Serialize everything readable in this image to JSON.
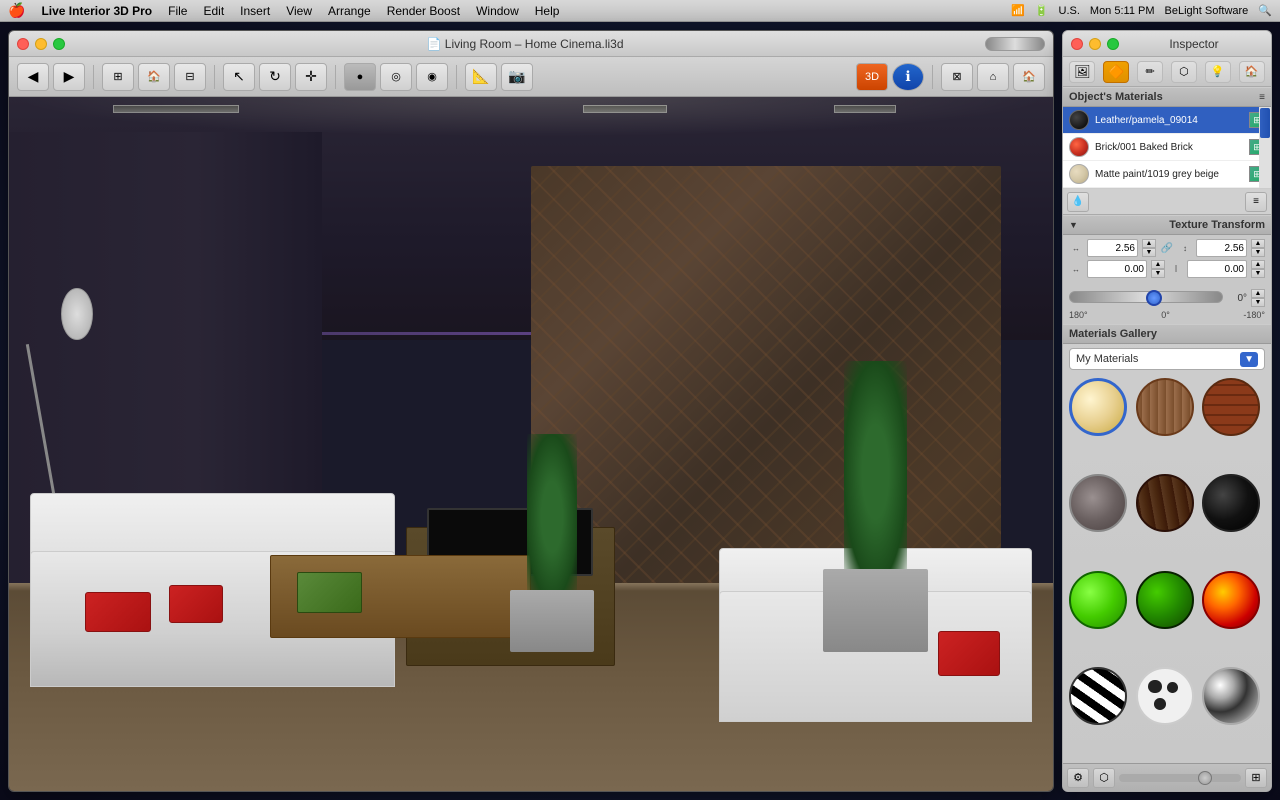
{
  "menubar": {
    "apple": "🍎",
    "app_name": "Live Interior 3D Pro",
    "menus": [
      "File",
      "Edit",
      "Insert",
      "View",
      "Arrange",
      "Render Boost",
      "Window",
      "Help"
    ],
    "right": {
      "time": "Mon 5:11 PM",
      "brand": "BeLight Software",
      "locale": "U.S."
    }
  },
  "window": {
    "title": "Living Room – Home Cinema.li3d",
    "title_icon": "📄"
  },
  "inspector": {
    "title": "Inspector",
    "tabs": [
      {
        "id": "render",
        "icon": "🖼",
        "active": false
      },
      {
        "id": "material",
        "icon": "●",
        "active": true
      },
      {
        "id": "edit",
        "icon": "✏",
        "active": false
      },
      {
        "id": "model",
        "icon": "⬡",
        "active": false
      },
      {
        "id": "light",
        "icon": "💡",
        "active": false
      },
      {
        "id": "arch",
        "icon": "🏠",
        "active": false
      }
    ],
    "objects_materials_label": "Object's Materials",
    "materials": [
      {
        "name": "Leather/pamela_09014",
        "color": "#2a2a2a",
        "selected": true
      },
      {
        "name": "Brick/001 Baked Brick",
        "color": "#cc3322",
        "selected": false
      },
      {
        "name": "Matte paint/1019 grey beige",
        "color": "#d4c8a8",
        "selected": false
      }
    ],
    "texture_transform": {
      "label": "Texture Transform",
      "scale_h": "2.56",
      "scale_v": "2.56",
      "offset_h": "0.00",
      "offset_v": "0.00",
      "angle": "0°",
      "angle_min": "180°",
      "angle_zero": "0°",
      "angle_max": "-180°"
    },
    "gallery": {
      "label": "Materials Gallery",
      "dropdown_value": "My Materials",
      "items": [
        {
          "id": "cream",
          "class": "mat-cream"
        },
        {
          "id": "wood1",
          "class": "mat-wood1"
        },
        {
          "id": "brick",
          "class": "mat-brick"
        },
        {
          "id": "stone",
          "class": "mat-stone"
        },
        {
          "id": "dark-wood",
          "class": "mat-dark-wood"
        },
        {
          "id": "black",
          "class": "mat-black"
        },
        {
          "id": "green-bright",
          "class": "mat-green-bright"
        },
        {
          "id": "green-dark",
          "class": "mat-green-dark"
        },
        {
          "id": "fire",
          "class": "mat-fire"
        },
        {
          "id": "zebra",
          "class": "mat-zebra"
        },
        {
          "id": "spot",
          "class": "mat-spot"
        },
        {
          "id": "chrome",
          "class": "mat-chrome"
        }
      ]
    }
  }
}
